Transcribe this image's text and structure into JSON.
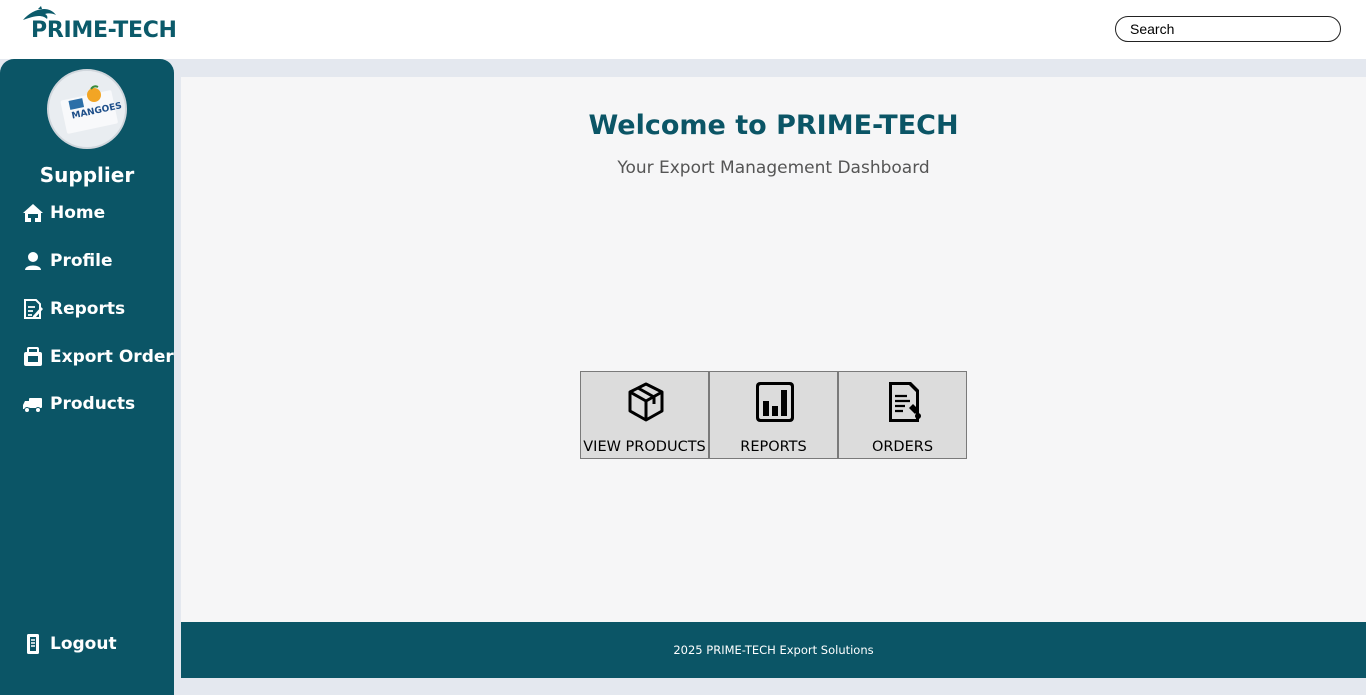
{
  "header": {
    "brand_name": "PRIME-TECH",
    "brand_icon": "dolphin-logo-icon",
    "search_placeholder": "Search"
  },
  "sidebar": {
    "avatar_icon": "mangoes-avatar",
    "role": "Supplier",
    "items": [
      {
        "label": "Home",
        "icon": "home-icon"
      },
      {
        "label": "Profile",
        "icon": "user-icon"
      },
      {
        "label": "Reports",
        "icon": "report-edit-icon"
      },
      {
        "label": "Export Order",
        "icon": "export-order-icon"
      },
      {
        "label": "Products",
        "icon": "delivery-truck-icon"
      }
    ],
    "logout_label": "Logout",
    "logout_icon": "logout-icon"
  },
  "main": {
    "title": "Welcome to PRIME-TECH",
    "subtitle": "Your Export Management Dashboard",
    "tiles": [
      {
        "label": "VIEW PRODUCTS",
        "icon": "package-box-icon"
      },
      {
        "label": "REPORTS",
        "icon": "bar-chart-icon"
      },
      {
        "label": "ORDERS",
        "icon": "order-document-icon"
      }
    ]
  },
  "footer": {
    "text": "2025 PRIME-TECH Export Solutions"
  },
  "colors": {
    "primary": "#0b5566",
    "background": "#e4e8ef",
    "main_bg": "#f6f6f7",
    "tile_bg": "#dcdcdc"
  }
}
